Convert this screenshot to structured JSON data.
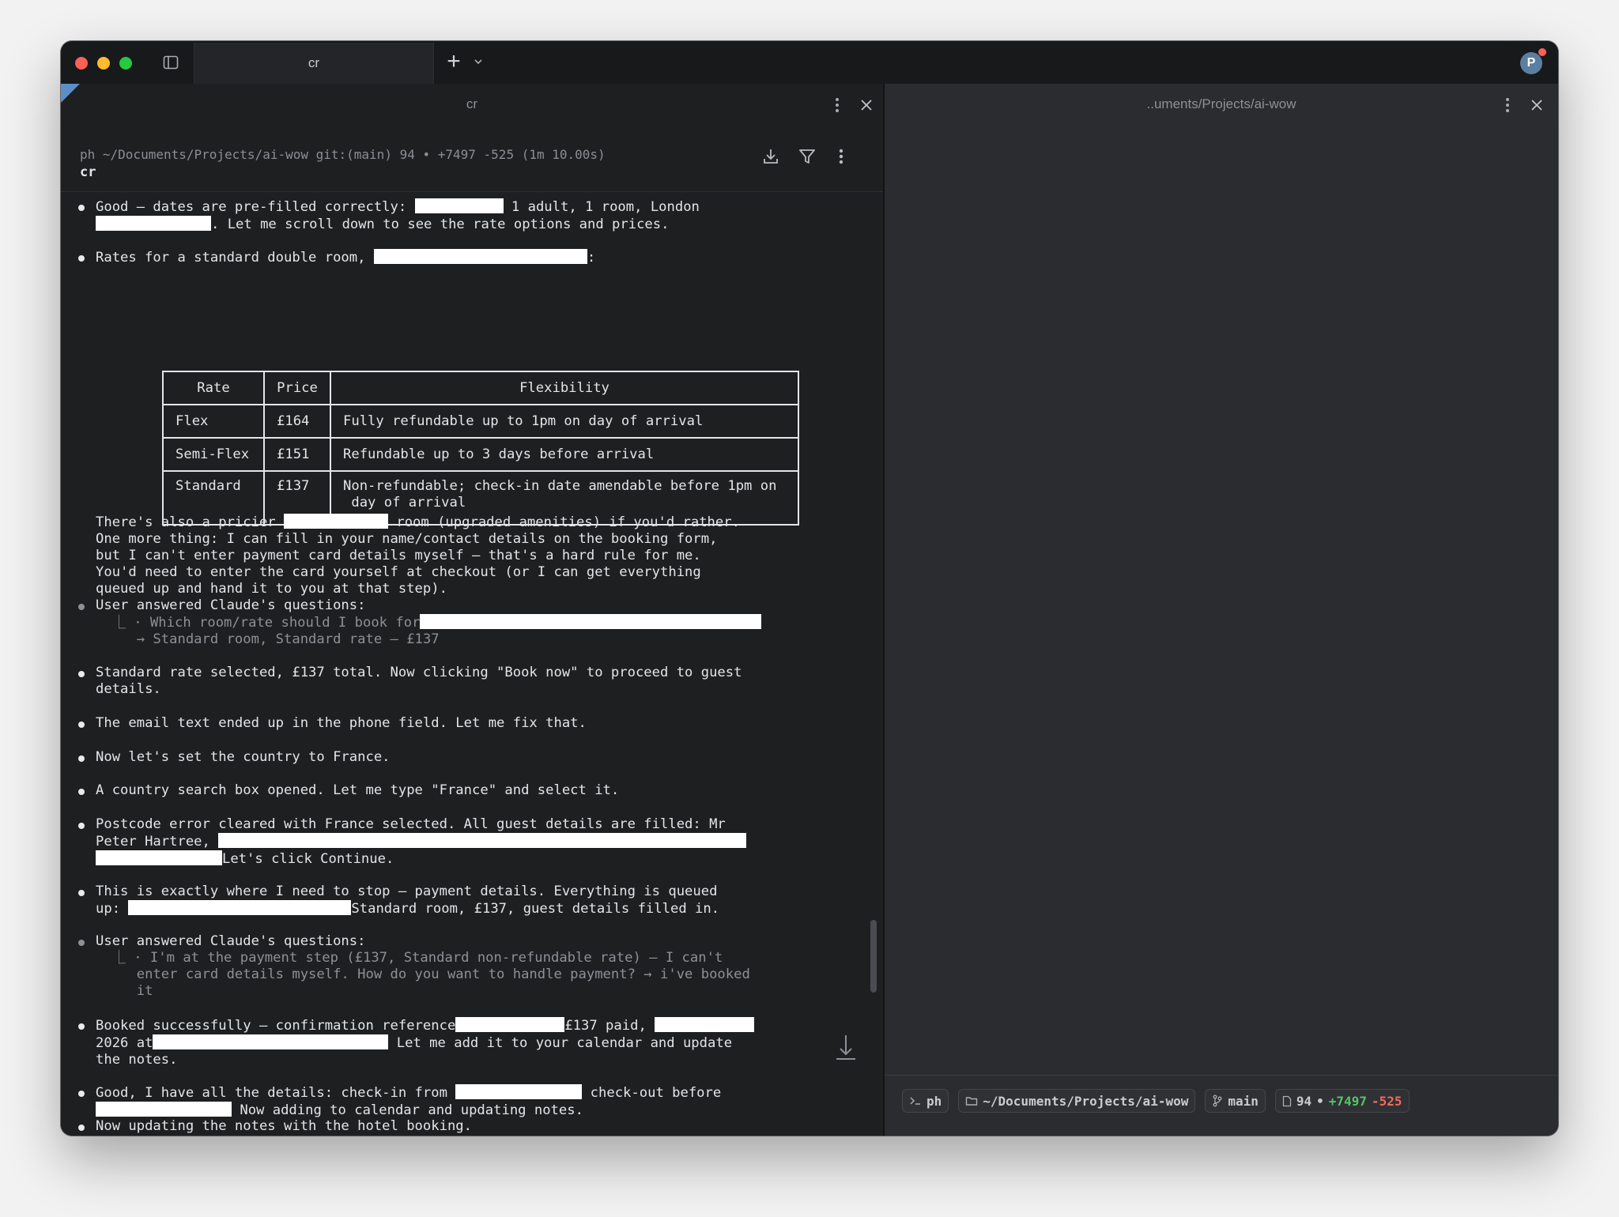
{
  "window": {
    "tab_title": "cr",
    "new_tab_glyph": "+",
    "avatar_initial": "P"
  },
  "left_pane": {
    "title": "cr",
    "prompt_line": "ph ~/Documents/Projects/ai-wow git:(main) 94 • +7497 -525 (1m 10.00s)",
    "command": "cr"
  },
  "right_pane": {
    "title": "..uments/Projects/ai-wow"
  },
  "terminal": {
    "m1": {
      "a": "Good — dates are pre-filled correctly: ",
      "b": " 1 adult, 1 room, London",
      "c": ". Let me scroll down to see the rate options and prices."
    },
    "m2": {
      "a": "Rates for a standard double room, ",
      "b": ":"
    },
    "table": {
      "headers": [
        "Rate",
        "Price",
        "Flexibility"
      ],
      "rows": [
        [
          "Flex",
          "£164",
          "Fully refundable up to 1pm on day of arrival"
        ],
        [
          "Semi-Flex",
          "£151",
          "Refundable up to 3 days before arrival"
        ],
        [
          "Standard",
          "£137",
          "Non-refundable; check-in date amendable before 1pm on\n day of arrival"
        ]
      ]
    },
    "para": {
      "a": "There's also a pricier ",
      "b": " room (upgraded amenities) if you'd rather.\nOne more thing: I can fill in your name/contact details on the booking form,\nbut I can't enter payment card details myself — that's a hard rule for me.\nYou'd need to enter the card yourself at checkout (or I can get everything\nqueued up and hand it to you at that step)."
    },
    "q1": {
      "title": "User answered Claude's questions:",
      "line1": "  ⎿ · Which room/rate should I book for",
      "line2": "     → Standard room, Standard rate — £137"
    },
    "m3": "Standard rate selected, £137 total. Now clicking \"Book now\" to proceed to guest\ndetails.",
    "m4": "The email text ended up in the phone field. Let me fix that.",
    "m5": "Now let's set the country to France.",
    "m6": "A country search box opened. Let me type \"France\" and select it.",
    "m7": {
      "a": "Postcode error cleared with France selected. All guest details are filled: Mr\nPeter Hartree, ",
      "b": "Let's click Continue."
    },
    "m8": {
      "a": "This is exactly where I need to stop — payment details. Everything is queued\nup: ",
      "b": "Standard room, £137, guest details filled in."
    },
    "q2": {
      "title": "User answered Claude's questions:",
      "body": "  ⎿ · I'm at the payment step (£137, Standard non-refundable rate) — I can't\n     enter card details myself. How do you want to handle payment? → i've booked\n     it"
    },
    "m9": {
      "a": "Booked successfully — confirmation reference",
      "b": "£137 paid, ",
      "c": "2026 at",
      "d": " Let me add it to your calendar and update\nthe notes."
    },
    "m10": {
      "a": "Good, I have all the details: check-in from ",
      "b": " check-out before",
      "c": " Now adding to calendar and updating notes."
    },
    "m11": "Now updating the notes with the hotel booking."
  },
  "status_chips": {
    "shell": "ph",
    "path": "~/Documents/Projects/ai-wow",
    "branch": "main",
    "files": "94",
    "sep": "•",
    "added": "+7497",
    "removed": "-525"
  },
  "colors": {
    "accent_blue": "#5b8fc6",
    "added_green": "#55c46a",
    "removed_red": "#ef6a5e"
  }
}
